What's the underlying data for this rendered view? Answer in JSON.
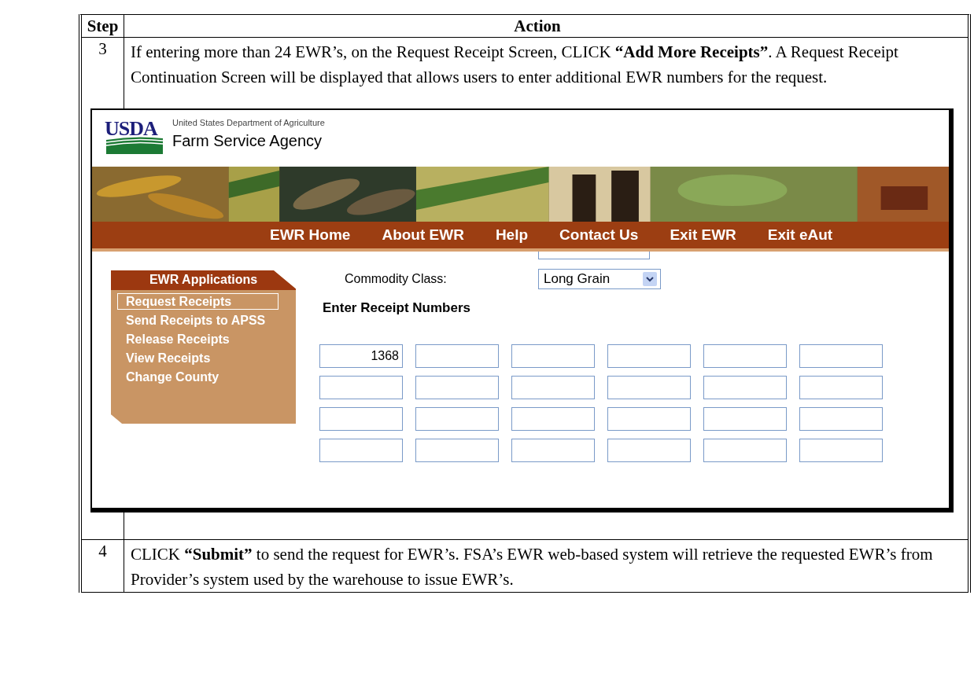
{
  "table": {
    "columns": [
      "Step",
      "Action"
    ],
    "rows": [
      {
        "step": "3",
        "text": "If entering more than 24 EWR’s, on the Request Receipt Screen, CLICK **“Add More Receipts”**.  A Request Receipt Continuation Screen will be displayed that allows users to enter additional EWR numbers for the request.",
        "screenshot": {
          "logo": "USDA",
          "department": "United States Department of Agriculture",
          "agency": "Farm Service Agency",
          "nav": [
            "EWR Home",
            "About EWR",
            "Help",
            "Contact Us",
            "Exit EWR",
            "Exit eAut"
          ],
          "sidebar": {
            "title": "EWR Applications",
            "items": [
              {
                "label": "Request Receipts",
                "selected": true
              },
              {
                "label": "Send Receipts to APSS",
                "selected": false
              },
              {
                "label": "Release Receipts",
                "selected": false
              },
              {
                "label": "View Receipts",
                "selected": false
              },
              {
                "label": "Change County",
                "selected": false
              }
            ]
          },
          "commodity_class": {
            "label": "Commodity Class:",
            "value": "Long Grain"
          },
          "section_title": "Enter Receipt Numbers",
          "receipt_fields": [
            {
              "kind": "filled",
              "value": "1368"
            },
            {
              "kind": "empty"
            },
            {
              "kind": "empty"
            },
            {
              "kind": "empty"
            },
            {
              "kind": "empty"
            },
            {
              "kind": "empty"
            },
            {
              "kind": "empty"
            },
            {
              "kind": "empty"
            },
            {
              "kind": "empty"
            },
            {
              "kind": "empty"
            },
            {
              "kind": "empty"
            },
            {
              "kind": "empty"
            },
            {
              "kind": "empty"
            },
            {
              "kind": "empty"
            },
            {
              "kind": "empty"
            },
            {
              "kind": "empty"
            },
            {
              "kind": "empty"
            },
            {
              "kind": "empty"
            },
            {
              "kind": "empty"
            },
            {
              "kind": "empty"
            },
            {
              "kind": "empty"
            },
            {
              "kind": "empty"
            },
            {
              "kind": "empty"
            },
            {
              "kind": "empty"
            }
          ]
        }
      },
      {
        "step": "4",
        "text": "CLICK **“Submit”** to send the request for EWR’s.  FSA’s EWR web-based system will retrieve the requested EWR’s from Provider’s system used by the warehouse to issue EWR’s."
      }
    ]
  }
}
